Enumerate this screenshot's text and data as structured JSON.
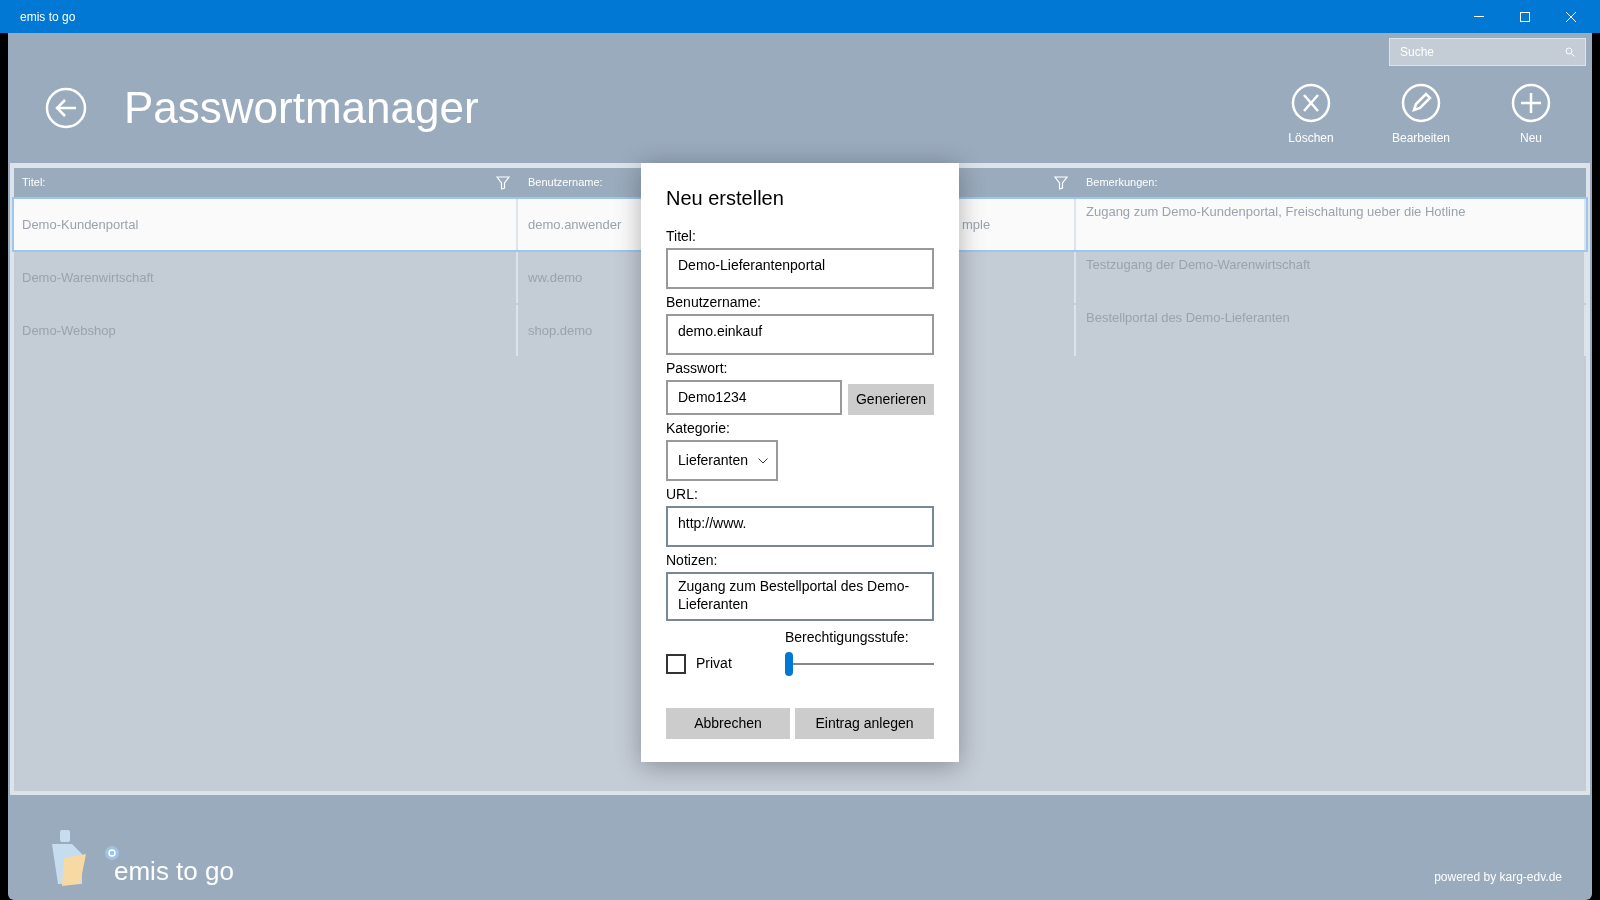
{
  "window": {
    "title": "emis to go"
  },
  "search": {
    "placeholder": "Suche"
  },
  "page": {
    "title": "Passwortmanager"
  },
  "toolbar": [
    {
      "kind": "delete",
      "label": "Löschen"
    },
    {
      "kind": "edit",
      "label": "Bearbeiten"
    },
    {
      "kind": "new",
      "label": "Neu"
    }
  ],
  "table": {
    "columns": [
      {
        "label": "Titel:",
        "filter": true
      },
      {
        "label": "Benutzername:",
        "filter": false
      },
      {
        "filter": true
      },
      {
        "label": "Bemerkungen:",
        "filter": false
      }
    ],
    "rows": [
      {
        "selected": true,
        "cells": [
          "Demo-Kundenportal",
          "demo.anwender",
          "mple",
          "Zugang zum Demo-Kundenportal, Freischaltung ueber die Hotline"
        ]
      },
      {
        "selected": false,
        "cells": [
          "Demo-Warenwirtschaft",
          "ww.demo",
          null,
          "Testzugang der Demo-Warenwirtschaft"
        ]
      },
      {
        "selected": false,
        "cells": [
          "Demo-Webshop",
          "shop.demo",
          null,
          "Bestellportal des Demo-Lieferanten"
        ]
      }
    ]
  },
  "dialog": {
    "title": "Neu erstellen",
    "fields": [
      {
        "kind": "text",
        "label": "Titel:",
        "value": "Demo-Lieferantenportal"
      },
      {
        "kind": "text",
        "label": "Benutzername:",
        "value": "demo.einkauf"
      },
      {
        "kind": "password",
        "label": "Passwort:",
        "value": "Demo1234",
        "button": "Generieren"
      },
      {
        "kind": "select",
        "label": "Kategorie:",
        "value": "Lieferanten"
      },
      {
        "kind": "text",
        "label": "URL:",
        "value": "http://www."
      },
      {
        "kind": "textarea",
        "label": "Notizen:",
        "value": "Zugang zum Bestellportal des Demo-Lieferanten"
      }
    ],
    "private": {
      "label": "Privat",
      "checked": false
    },
    "permission": {
      "label": "Berechtigungsstufe:",
      "level": 0
    },
    "buttons": [
      "Abbrechen",
      "Eintrag anlegen"
    ]
  },
  "footer": {
    "brand": "emis to go",
    "credit": "powered by karg-edv.de"
  }
}
